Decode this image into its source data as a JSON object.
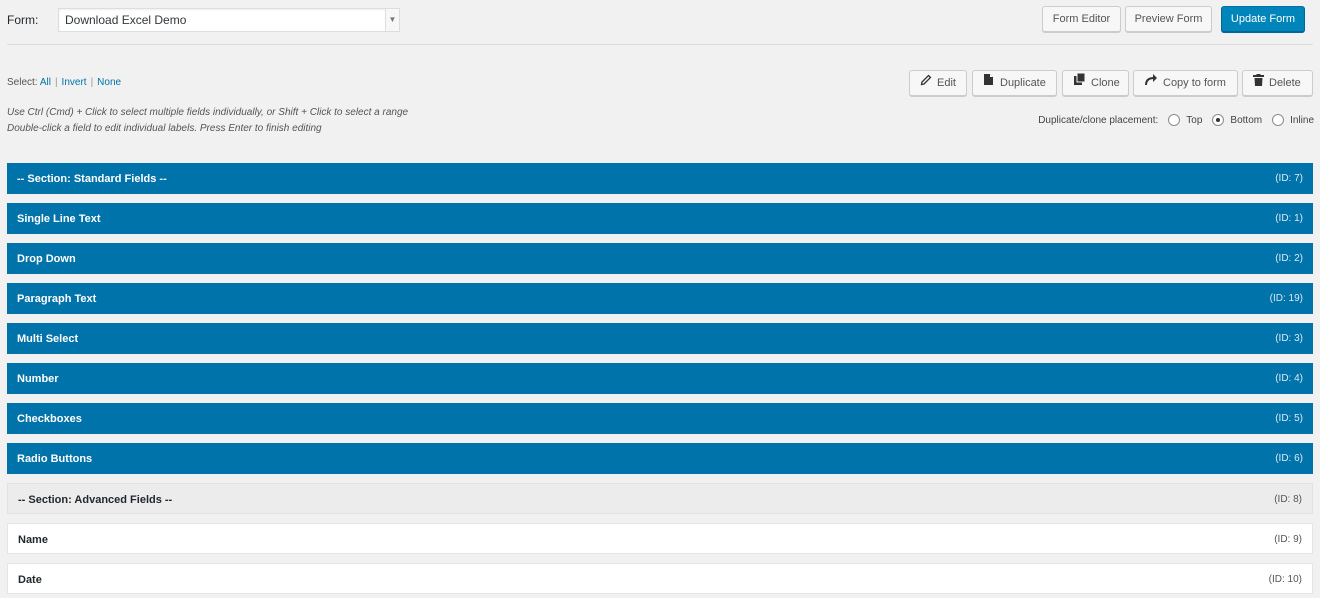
{
  "formbar": {
    "label": "Form:",
    "selected_form": "Download Excel Demo",
    "form_editor": "Form Editor",
    "preview_form": "Preview Form",
    "update_form": "Update Form"
  },
  "select": {
    "prefix": "Select:",
    "all": "All",
    "invert": "Invert",
    "none": "None"
  },
  "toolbar": {
    "edit": "Edit",
    "duplicate": "Duplicate",
    "clone": "Clone",
    "copy_to_form": "Copy to form",
    "delete": "Delete"
  },
  "hints": {
    "line1": "Use Ctrl (Cmd) + Click to select multiple fields individually, or Shift + Click to select a range",
    "line2": "Double-click a field to edit individual labels. Press Enter to finish editing"
  },
  "placement": {
    "label": "Duplicate/clone placement:",
    "options": [
      "Top",
      "Bottom",
      "Inline"
    ],
    "selected": "Bottom"
  },
  "fields": [
    {
      "label": "-- Section: Standard Fields --",
      "id": "(ID: 7)",
      "state": "selected"
    },
    {
      "label": "Single Line Text",
      "id": "(ID: 1)",
      "state": "selected"
    },
    {
      "label": "Drop Down",
      "id": "(ID: 2)",
      "state": "selected"
    },
    {
      "label": "Paragraph Text",
      "id": "(ID: 19)",
      "state": "selected"
    },
    {
      "label": "Multi Select",
      "id": "(ID: 3)",
      "state": "selected"
    },
    {
      "label": "Number",
      "id": "(ID: 4)",
      "state": "selected"
    },
    {
      "label": "Checkboxes",
      "id": "(ID: 5)",
      "state": "selected"
    },
    {
      "label": "Radio Buttons",
      "id": "(ID: 6)",
      "state": "selected"
    },
    {
      "label": "-- Section: Advanced Fields --",
      "id": "(ID: 8)",
      "state": "section"
    },
    {
      "label": "Name",
      "id": "(ID: 9)",
      "state": "unselected"
    },
    {
      "label": "Date",
      "id": "(ID: 10)",
      "state": "unselected"
    }
  ],
  "colors": {
    "selected_bg": "#0073aa",
    "primary_button": "#0085ba"
  }
}
